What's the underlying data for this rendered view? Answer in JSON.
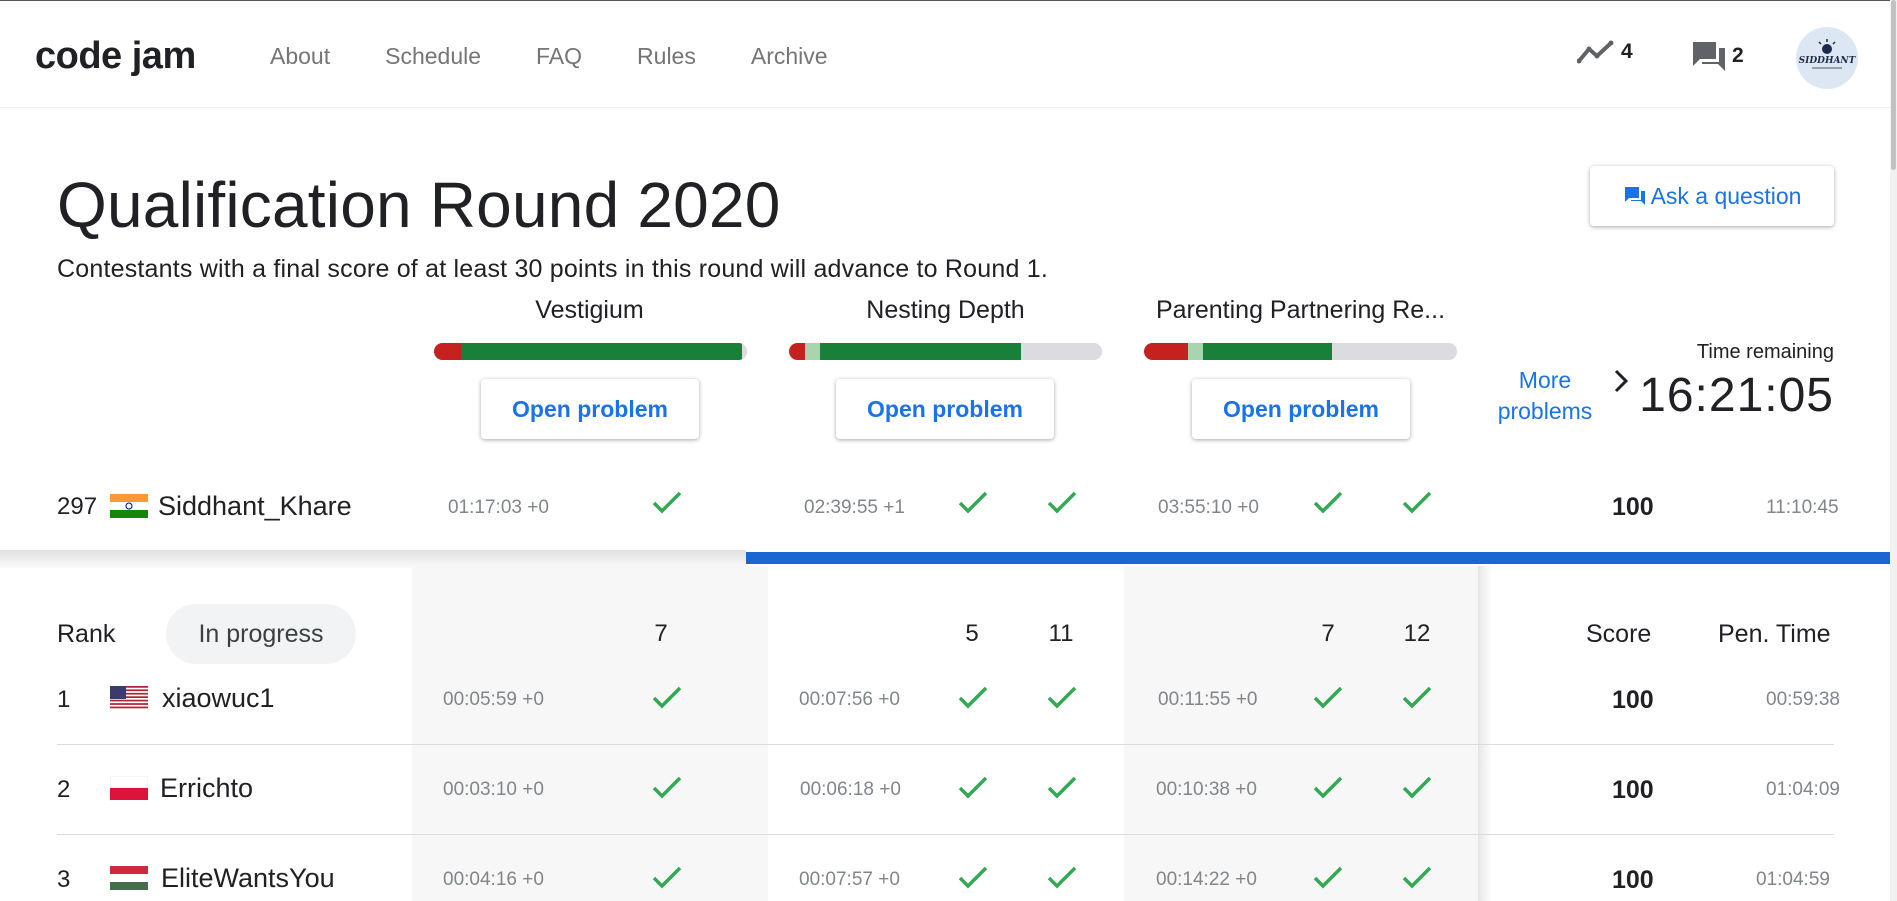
{
  "header": {
    "logo": "code jam",
    "nav": [
      "About",
      "Schedule",
      "FAQ",
      "Rules",
      "Archive"
    ],
    "activity_count": "4",
    "messages_count": "2",
    "avatar_text": "SIDDHANT"
  },
  "round": {
    "title": "Qualification Round 2020",
    "subtitle": "Contestants with a final score of at least 30 points in this round will advance to Round 1.",
    "ask_label": "Ask a question"
  },
  "problems": [
    {
      "name": "Vestigium",
      "open_label": "Open problem",
      "bar": {
        "red": 0.085,
        "light": 0,
        "green": 0.9,
        "gray": 0.015
      }
    },
    {
      "name": "Nesting Depth",
      "open_label": "Open problem",
      "bar": {
        "red": 0.05,
        "light": 0.05,
        "green": 0.64,
        "gray": 0.26
      }
    },
    {
      "name": "Parenting Partnering Re...",
      "open_label": "Open problem",
      "bar": {
        "red": 0.14,
        "light": 0.05,
        "green": 0.41,
        "gray": 0.4
      }
    }
  ],
  "more_problems_label": "More problems",
  "time": {
    "label": "Time remaining",
    "value": "16:21:05"
  },
  "current_user": {
    "rank": "297",
    "name": "Siddhant_Khare",
    "country": "india",
    "p1_time": "01:17:03 +0",
    "p2_time": "02:39:55 +1",
    "p3_time": "03:55:10 +0",
    "score": "100",
    "penalty": "11:10:45"
  },
  "scoreboard": {
    "rank_header": "Rank",
    "filter_label": "In progress",
    "points": [
      "7",
      "5",
      "11",
      "7",
      "12"
    ],
    "score_header": "Score",
    "pen_header": "Pen. Time",
    "rows": [
      {
        "rank": "1",
        "name": "xiaowuc1",
        "country": "usa",
        "p1_time": "00:05:59 +0",
        "p2_time": "00:07:56 +0",
        "p3_time": "00:11:55 +0",
        "score": "100",
        "penalty": "00:59:38"
      },
      {
        "rank": "2",
        "name": "Errichto",
        "country": "poland",
        "p1_time": "00:03:10 +0",
        "p2_time": "00:06:18 +0",
        "p3_time": "00:10:38 +0",
        "score": "100",
        "penalty": "01:04:09"
      },
      {
        "rank": "3",
        "name": "EliteWantsYou",
        "country": "hungary",
        "p1_time": "00:04:16 +0",
        "p2_time": "00:07:57 +0",
        "p3_time": "00:14:22 +0",
        "score": "100",
        "penalty": "01:04:59"
      }
    ]
  },
  "colors": {
    "accent": "#1a73e8",
    "green": "#188038",
    "red": "#c5221f",
    "check": "#34a853"
  }
}
